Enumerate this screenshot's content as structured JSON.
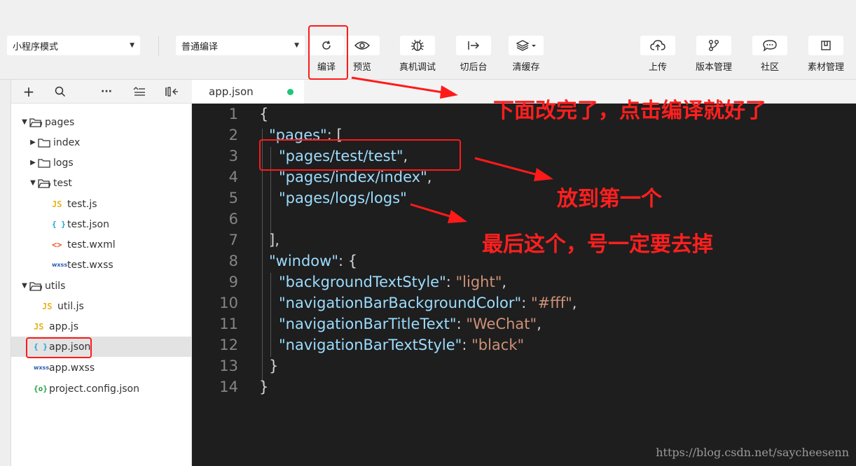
{
  "toolbar": {
    "mode_select": "小程序模式",
    "compile_select": "普通编译",
    "tools": [
      {
        "label": "编译",
        "icon": "refresh-icon"
      },
      {
        "label": "预览",
        "icon": "eye-icon"
      },
      {
        "label": "真机调试",
        "icon": "bug-icon"
      },
      {
        "label": "切后台",
        "icon": "switch-background-icon"
      },
      {
        "label": "清缓存",
        "icon": "layers-icon"
      },
      {
        "label": "上传",
        "icon": "cloud-upload-icon"
      },
      {
        "label": "版本管理",
        "icon": "branch-icon"
      },
      {
        "label": "社区",
        "icon": "chat-bubble-icon"
      },
      {
        "label": "素材管理",
        "icon": "archive-icon"
      }
    ]
  },
  "sidebar": {
    "tree": [
      {
        "name": "pages",
        "type": "folder",
        "expanded": true
      },
      {
        "name": "index",
        "type": "folder",
        "expanded": false
      },
      {
        "name": "logs",
        "type": "folder",
        "expanded": false
      },
      {
        "name": "test",
        "type": "folder",
        "expanded": true
      },
      {
        "name": "test.js",
        "type": "js"
      },
      {
        "name": "test.json",
        "type": "json"
      },
      {
        "name": "test.wxml",
        "type": "wxml"
      },
      {
        "name": "test.wxss",
        "type": "wxss"
      },
      {
        "name": "utils",
        "type": "folder",
        "expanded": true
      },
      {
        "name": "util.js",
        "type": "js"
      },
      {
        "name": "app.js",
        "type": "js"
      },
      {
        "name": "app.json",
        "type": "json",
        "selected": true
      },
      {
        "name": "app.wxss",
        "type": "wxss"
      },
      {
        "name": "project.config.json",
        "type": "config"
      }
    ],
    "icon_labels": {
      "js": "JS",
      "json": "{ }",
      "wxml": "<>",
      "wxss": "wxss",
      "config": "{o}"
    }
  },
  "editor": {
    "tab": "app.json",
    "lines": [
      "1",
      "2",
      "3",
      "4",
      "5",
      "6",
      "7",
      "8",
      "9",
      "10",
      "11",
      "12",
      "13",
      "14"
    ],
    "code": {
      "l1": "{",
      "k_pages": "\"pages\"",
      "p_colon_bracket": ": [",
      "s_test": "\"pages/test/test\"",
      "s_index": "\"pages/index/index\"",
      "s_logs": "\"pages/logs/logs\"",
      "comma": ",",
      "close_bracket": "],",
      "k_window": "\"window\"",
      "p_colon_brace": ": {",
      "k_bts": "\"backgroundTextStyle\"",
      "s_light": "\"light\"",
      "k_nbbc": "\"navigationBarBackgroundColor\"",
      "s_fff": "\"#fff\"",
      "k_nbtt": "\"navigationBarTitleText\"",
      "s_wechat": "\"WeChat\"",
      "k_nbts": "\"navigationBarTextStyle\"",
      "s_black": "\"black\"",
      "colon": ": ",
      "close_brace": "}",
      "l14": "}"
    },
    "watermark": "https://blog.csdn.net/saycheesenn"
  },
  "annotations": {
    "compile_note": "下面改完了，点击编译就好了",
    "first_note": "放到第一个",
    "comma_note": "最后这个，号一定要去掉",
    "color": "#ff1a1a"
  }
}
